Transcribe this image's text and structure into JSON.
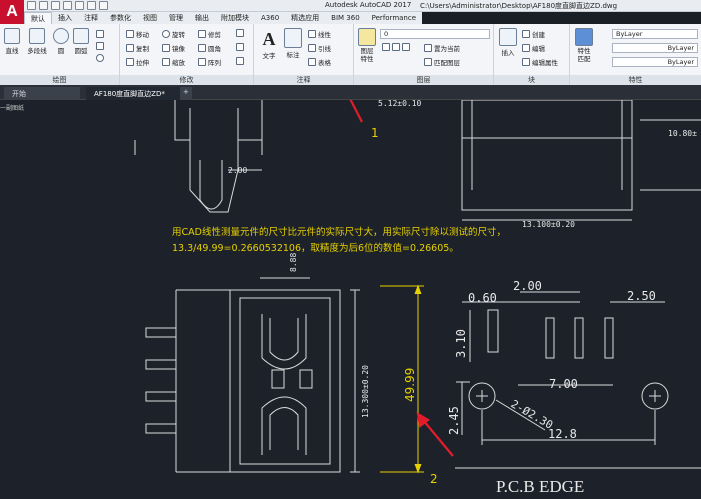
{
  "app": {
    "title": "Autodesk AutoCAD 2017",
    "path": "C:\\Users\\Administrator\\Desktop\\AF180度直脚直边ZD.dwg",
    "logo": "A"
  },
  "tabs": [
    "默认",
    "插入",
    "注释",
    "参数化",
    "视图",
    "管理",
    "输出",
    "附加模块",
    "A360",
    "精选应用",
    "BIM 360",
    "Performance"
  ],
  "ribbon": {
    "draw": {
      "label": "绘图",
      "line": "直线",
      "polyline": "多段线",
      "circle": "圆",
      "arc": "圆弧"
    },
    "modify": {
      "label": "修改",
      "move": "移动",
      "rotate": "旋转",
      "trim": "修剪",
      "copy": "复制",
      "mirror": "镜像",
      "fillet": "圆角",
      "stretch": "拉伸",
      "scale": "缩放",
      "array": "阵列"
    },
    "annotation": {
      "label": "注释",
      "text": "文字",
      "dimension": "标注",
      "linear": "线性",
      "leader": "引线",
      "table": "表格"
    },
    "layers": {
      "label": "图层",
      "properties": "图层\n特性",
      "current": "0",
      "make_current": "置为当前",
      "match": "匹配图层"
    },
    "block": {
      "label": "块",
      "insert": "插入",
      "create": "创建",
      "edit": "编辑",
      "edit_attr": "编辑属性"
    },
    "properties": {
      "label": "特性",
      "match": "特性\n匹配",
      "color": "ByLayer",
      "linetype": "ByLayer",
      "lineweight": "ByLayer"
    }
  },
  "doc_tabs": {
    "start": "开始",
    "file": "AF180度直脚直边ZD*",
    "plus": "+"
  },
  "canvas": {
    "note_line1": "用CAD线性测量元件的尺寸比元件的实际尺寸大，用实际尺寸除以测试的尺寸，",
    "note_line2": "13.3/49.99=0.2660532106，取精度为后6位的数值=0.26605。",
    "dims": {
      "d_2_00_left": "2.00",
      "d_13_100": "13.100±0.20",
      "d_10_8": "10.80±",
      "d_5_12": "5.12±0.10",
      "d_8_88": "8.88",
      "d_13_300": "13.300±0.20",
      "measured": "49.99",
      "p060": "0.60",
      "p200": "2.00",
      "p250": "2.50",
      "p310": "3.10",
      "p700": "7.00",
      "p245": "2.45",
      "p2d": "2-Ø2.30",
      "p128": "12.8"
    },
    "marker1": "1",
    "marker2": "2",
    "pcb_label": "P.C.B  EDGE",
    "side_text": "一副图纸"
  },
  "colors": {
    "accent": "#c8102e",
    "canvas": "#1d222a",
    "annotation": "#e6d000",
    "arrow": "#e11d2a"
  }
}
